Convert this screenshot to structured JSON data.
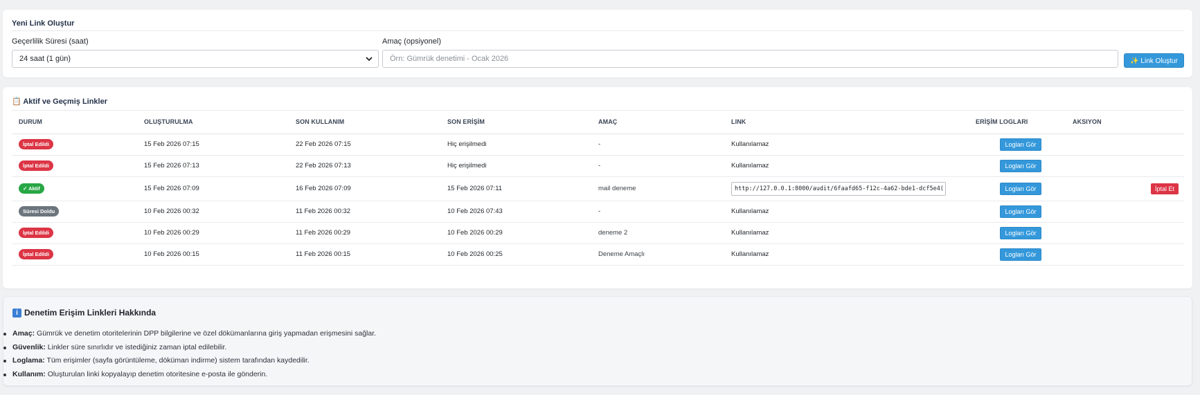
{
  "create": {
    "title": "Yeni Link Oluştur",
    "validity_label": "Geçerlilik Süresi (saat)",
    "validity_value": "24 saat (1 gün)",
    "purpose_label": "Amaç (opsiyonel)",
    "purpose_placeholder": "Örn: Gümrük denetimi - Ocak 2026",
    "create_button": "✨ Link Oluştur"
  },
  "links": {
    "title": "📋 Aktif ve Geçmiş Linkler",
    "columns": [
      "DURUM",
      "OLUŞTURULMA",
      "SON KULLANIM",
      "SON ERİŞİM",
      "AMAÇ",
      "LINK",
      "ERİŞİM LOGLARI",
      "AKSIYON"
    ],
    "rows": [
      {
        "status": "İptal Edildi",
        "status_color": "#dc3545",
        "created": "15 Feb 2026 07:15",
        "expires": "22 Feb 2026 07:15",
        "last_access": "Hiç erişilmedi",
        "purpose": "-",
        "link": "Kullanılamaz",
        "logs": "Logları Gör",
        "action": ""
      },
      {
        "status": "İptal Edildi",
        "status_color": "#dc3545",
        "created": "15 Feb 2026 07:13",
        "expires": "22 Feb 2026 07:13",
        "last_access": "Hiç erişilmedi",
        "purpose": "-",
        "link": "Kullanılamaz",
        "logs": "Logları Gör",
        "action": ""
      },
      {
        "status": "✓ Aktif",
        "status_color": "#28a745",
        "created": "15 Feb 2026 07:09",
        "expires": "16 Feb 2026 07:09",
        "last_access": "15 Feb 2026 07:11",
        "purpose": "mail deneme",
        "link": "http://127.0.0.1:8000/audit/6faafd65-f12c-4a62-bde1-dcf5e4(",
        "logs": "Logları Gör",
        "action": "İptal Et"
      },
      {
        "status": "Süresi Doldu",
        "status_color": "#6c757d",
        "created": "10 Feb 2026 00:32",
        "expires": "11 Feb 2026 00:32",
        "last_access": "10 Feb 2026 07:43",
        "purpose": "-",
        "link": "Kullanılamaz",
        "logs": "Logları Gör",
        "action": ""
      },
      {
        "status": "İptal Edildi",
        "status_color": "#dc3545",
        "created": "10 Feb 2026 00:29",
        "expires": "11 Feb 2026 00:29",
        "last_access": "10 Feb 2026 00:29",
        "purpose": "deneme 2",
        "link": "Kullanılamaz",
        "logs": "Logları Gör",
        "action": ""
      },
      {
        "status": "İptal Edildi",
        "status_color": "#dc3545",
        "created": "10 Feb 2026 00:15",
        "expires": "11 Feb 2026 00:15",
        "last_access": "10 Feb 2026 00:25",
        "purpose": "Deneme Amaçlı",
        "link": "Kullanılamaz",
        "logs": "Logları Gör",
        "action": ""
      }
    ]
  },
  "info": {
    "title": "Denetim Erişim Linkleri Hakkında",
    "icon": "info-icon",
    "items": [
      {
        "term": "Amaç:",
        "text": " Gümrük ve denetim otoritelerinin DPP bilgilerine ve özel dökümanlarına giriş yapmadan erişmesini sağlar."
      },
      {
        "term": "Güvenlik:",
        "text": " Linkler süre sınırlıdır ve istediğiniz zaman iptal edilebilir."
      },
      {
        "term": "Loglama:",
        "text": " Tüm erişimler (sayfa görüntüleme, döküman indirme) sistem tarafından kaydedilir."
      },
      {
        "term": "Kullanım:",
        "text": " Oluşturulan linki kopyalayıp denetim otoritesine e-posta ile gönderin."
      }
    ]
  }
}
